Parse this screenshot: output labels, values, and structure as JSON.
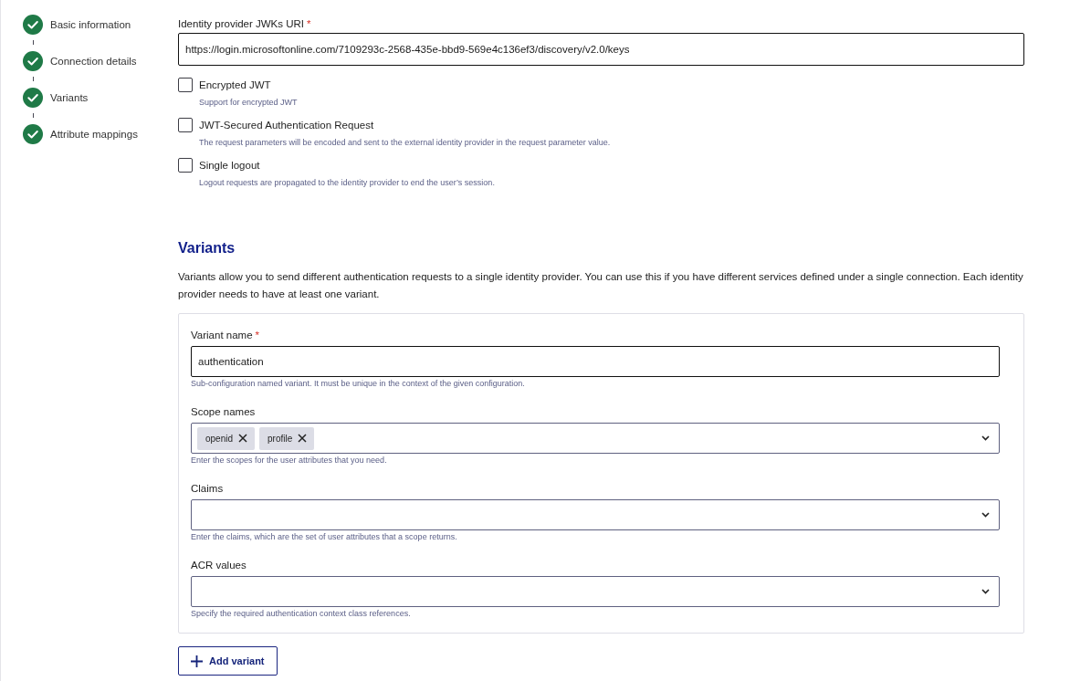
{
  "steps": [
    {
      "label": "Basic information",
      "completed": true
    },
    {
      "label": "Connection details",
      "completed": true
    },
    {
      "label": "Variants",
      "completed": true
    },
    {
      "label": "Attribute mappings",
      "completed": true
    }
  ],
  "jwks_uri": {
    "label": "Identity provider JWKs URI",
    "required_mark": "*",
    "value": "https://login.microsoftonline.com/7109293c-2568-435e-bbd9-569e4c136ef3/discovery/v2.0/keys"
  },
  "options": [
    {
      "label": "Encrypted JWT",
      "description": "Support for encrypted JWT",
      "checked": false
    },
    {
      "label": "JWT-Secured Authentication Request",
      "description": "The request parameters will be encoded and sent to the external identity provider in the request parameter value.",
      "checked": false
    },
    {
      "label": "Single logout",
      "description": "Logout requests are propagated to the identity provider to end the user’s session.",
      "checked": false
    }
  ],
  "variants": {
    "title": "Variants",
    "description": "Variants allow you to send different authentication requests to a single identity provider. You can use this if you have different services defined under a single connection. Each identity provider needs to have at least one variant.",
    "cards": [
      {
        "fields": [
          {
            "kind": "text",
            "label": "Variant name",
            "required_mark": "*",
            "value": "authentication",
            "helper": "Sub-configuration named variant. It must be unique in the context of the given configuration."
          },
          {
            "kind": "select",
            "label": "Scope names",
            "chips": [
              {
                "label": "openid"
              },
              {
                "label": "profile"
              }
            ],
            "helper": "Enter the scopes for the user attributes that you need."
          },
          {
            "kind": "select",
            "label": "Claims",
            "helper": "Enter the claims, which are the set of user attributes that a scope returns."
          },
          {
            "kind": "select",
            "label": "ACR values",
            "helper": "Specify the required authentication context class references."
          }
        ]
      }
    ],
    "add_button": "Add variant"
  }
}
